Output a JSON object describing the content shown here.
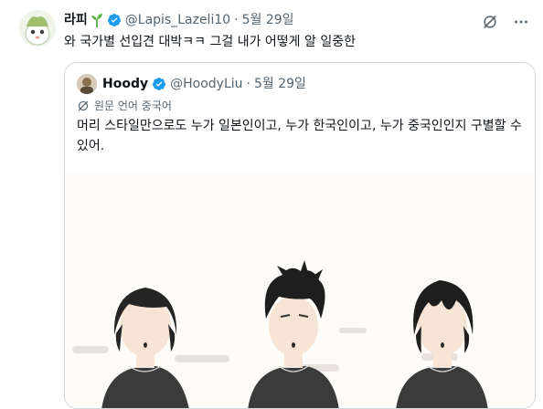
{
  "tweet": {
    "author_name": "라피",
    "handle": "@Lapis_Lazeli10",
    "separator": "·",
    "date": "5월 29일",
    "text": "와 국가별 선입견 대박ㅋㅋ 그걸 내가 어떻게 알 일중한",
    "icons": [
      "sprout-icon",
      "verified-badge-icon",
      "grok-icon",
      "more-icon"
    ],
    "accent_color": "#1d9bf0"
  },
  "quoted": {
    "author_name": "Hoody",
    "handle": "@HoodyLiu",
    "separator": "·",
    "date": "5월 29일",
    "translate_label": "원문 언어 중국어",
    "text": "머리 스타일만으로도 누가 일본인이고, 누가 한국인이고, 누가 중국인인지 구별할 수 있어."
  }
}
